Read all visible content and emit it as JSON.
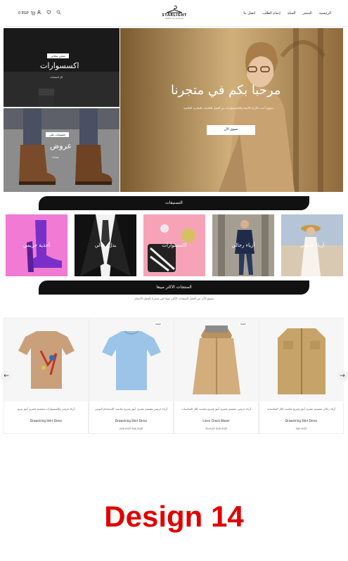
{
  "header": {
    "cart_text": "0 EGP",
    "nav": [
      "الرئيسية",
      "المتجر",
      "السلة",
      "إتمام الطلب",
      "اتصل بنا"
    ],
    "logo_text": "STARLIGHT",
    "logo_sub": "fashion for everyone"
  },
  "hero": {
    "title": "مرحبا بكم في متجرنا",
    "subtitle": "تسوق أحدث الأزياء الأنيقة والإكسسوارات من أفضل العلامات التجارية العالمية",
    "button": "تسوق الآن",
    "tile_top": {
      "tag": "شحن مجاني",
      "title": "اكسسوارات",
      "sub": "كل المنتجات"
    },
    "tile_bottom": {
      "tag": "خصومات على",
      "title": "عروض",
      "sub": "مفاجآت"
    }
  },
  "categories": {
    "heading": "التصنيفات",
    "items": [
      "أحذية حريمي",
      "بدل رجالي",
      "اكسسوارات",
      "أزياء رجالي",
      "أزياء حريمي"
    ]
  },
  "products": {
    "heading": "المنتجات الاكثر مبيعا",
    "subtitle": "تسوق الآن من أفضل المنتجات الأكثر مبيعا في متجرنا بأفضل الأسعار",
    "items": [
      {
        "desc": "أزياء حريمي وإكسسوارات بتصميم عصري أنيق مريح",
        "name": "Drawstring Shirt Dress",
        "price": "",
        "badge": ""
      },
      {
        "desc": "أزياء حريمي بتصميم عصري أنيق ومريح مناسب للاستخدام اليومي",
        "name": "Drawstring Shirt Dress",
        "price": "200 EGP 300 EGP",
        "badge": "SALE"
      },
      {
        "desc": "أزياء حريمي بتصميم عصري أنيق ومريح مناسب لكل المناسبات",
        "name": "Linen Check Blazer",
        "price": "30 EGP 300 EGP",
        "badge": "SALE"
      },
      {
        "desc": "أزياء رجالي بتصميم عصري أنيق ومريح مناسب لكل المناسبات",
        "name": "Drawstring Shirt Dress",
        "price": "300 EGP",
        "badge": ""
      }
    ]
  },
  "footer_label": "Design 14",
  "colors": {
    "accent": "#111111",
    "design_label": "#e10000"
  }
}
